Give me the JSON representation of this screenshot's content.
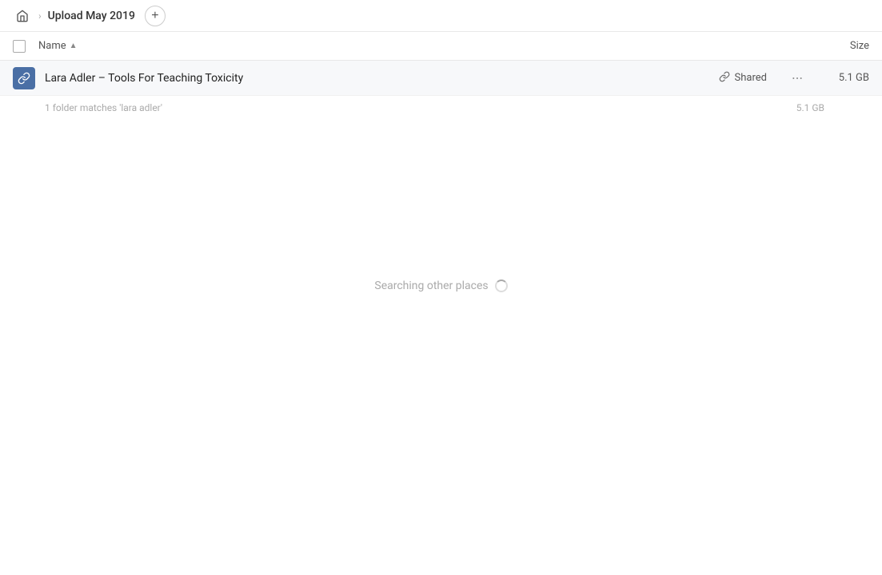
{
  "header": {
    "breadcrumb_label": "Upload May 2019",
    "add_button_label": "+",
    "home_icon": "home-icon"
  },
  "columns": {
    "name_label": "Name",
    "sort_indicator": "▲",
    "size_label": "Size"
  },
  "file_row": {
    "name": "Lara Adler – Tools For Teaching Toxicity",
    "shared_label": "Shared",
    "more_icon": "•••",
    "size": "5.1 GB",
    "icon": "link-file-icon"
  },
  "match_note": {
    "text": "1 folder matches 'lara adler'",
    "size": "5.1 GB"
  },
  "searching": {
    "text": "Searching other places"
  }
}
